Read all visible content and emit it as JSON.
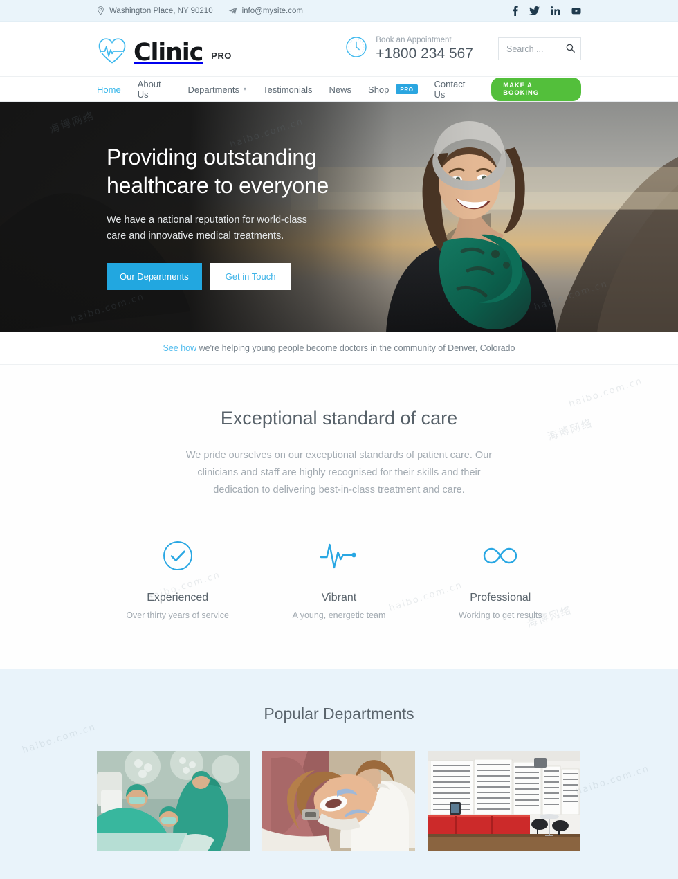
{
  "topbar": {
    "address": "Washington Place, NY 90210",
    "email": "info@mysite.com",
    "address_icon": "map-pin-icon",
    "email_icon": "paper-plane-icon",
    "social": [
      {
        "name": "facebook-icon",
        "label": "Facebook"
      },
      {
        "name": "twitter-icon",
        "label": "Twitter"
      },
      {
        "name": "linkedin-icon",
        "label": "LinkedIn"
      },
      {
        "name": "youtube-icon",
        "label": "YouTube"
      }
    ]
  },
  "header": {
    "logo_text": "Clinic",
    "logo_suffix": "PRO",
    "logo_icon": "heartbeat-heart-icon",
    "appointment_icon": "clock-icon",
    "appointment_label": "Book an Appointment",
    "appointment_phone": "+1800 234 567",
    "search_placeholder": "Search ...",
    "search_value": "",
    "search_icon": "search-icon"
  },
  "nav": {
    "items": [
      {
        "label": "Home",
        "active": true,
        "caret": false,
        "badge": null
      },
      {
        "label": "About Us",
        "active": false,
        "caret": false,
        "badge": null
      },
      {
        "label": "Departments",
        "active": false,
        "caret": true,
        "badge": null
      },
      {
        "label": "Testimonials",
        "active": false,
        "caret": false,
        "badge": null
      },
      {
        "label": "News",
        "active": false,
        "caret": false,
        "badge": null
      },
      {
        "label": "Shop",
        "active": false,
        "caret": false,
        "badge": "PRO"
      },
      {
        "label": "Contact Us",
        "active": false,
        "caret": false,
        "badge": null
      }
    ],
    "booking_button": "MAKE A BOOKING"
  },
  "hero": {
    "title_line1": "Providing outstanding",
    "title_line2": "healthcare to everyone",
    "subtitle_line1": "We have a national reputation for world-class",
    "subtitle_line2": "care and innovative medical treatments.",
    "primary_button": "Our Departments",
    "secondary_button": "Get in Touch",
    "image_alt": "smiling woman in grey beanie and green scarf in mountains"
  },
  "notice": {
    "link_text": "See how",
    "rest_text": " we're helping young people become doctors in the community of Denver, Colorado"
  },
  "care": {
    "heading": "Exceptional standard of care",
    "paragraph": "We pride ourselves on our exceptional standards of patient care. Our clinicians and staff are highly recognised for their skills and their dedication to delivering best-in-class treatment and care.",
    "features": [
      {
        "icon": "check-circle-icon",
        "title": "Experienced",
        "desc": "Over thirty years of service"
      },
      {
        "icon": "heartbeat-pulse-icon",
        "title": "Vibrant",
        "desc": "A young, energetic team"
      },
      {
        "icon": "infinity-icon",
        "title": "Professional",
        "desc": "Working to get results"
      }
    ]
  },
  "departments": {
    "heading": "Popular Departments",
    "cards": [
      {
        "name": "surgery-department-image",
        "alt": "surgeons operating under theatre lights"
      },
      {
        "name": "dental-department-image",
        "alt": "dentist treating patient in dental chair"
      },
      {
        "name": "optometry-department-image",
        "alt": "optician showroom with eyeglass display wall"
      }
    ]
  },
  "colors": {
    "accent_blue": "#2ba6e0",
    "hero_button_blue": "#22a7e0",
    "link_blue": "#54bdee",
    "booking_green": "#53bf3b",
    "topbar_bg": "#eaf4fa",
    "departments_bg": "#e9f3fa",
    "text_gray": "#5a6570",
    "muted_gray": "#a3abb2"
  },
  "watermarks": [
    "haibo.com.cn",
    "海博网络"
  ]
}
